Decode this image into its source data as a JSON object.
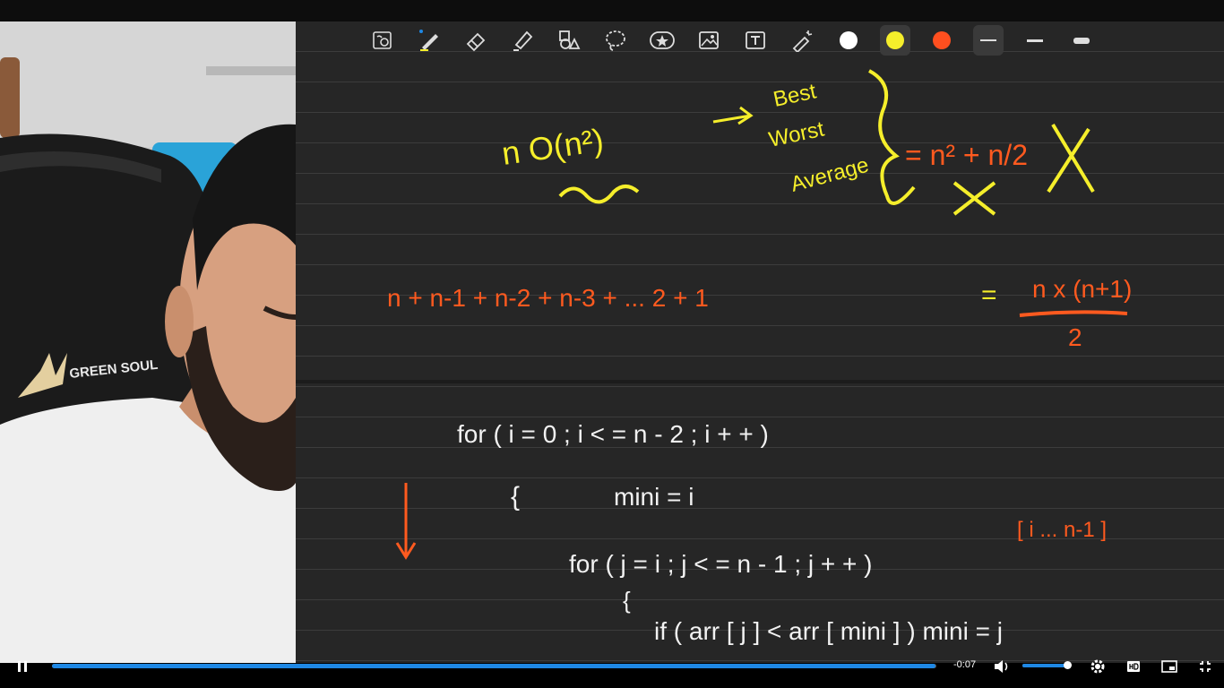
{
  "camera": {
    "chair_brand": "GREEN SOUL"
  },
  "toolbar": {
    "tools": [
      {
        "name": "lasso-zoom-icon"
      },
      {
        "name": "pen-icon"
      },
      {
        "name": "eraser-icon"
      },
      {
        "name": "highlighter-icon"
      },
      {
        "name": "shapes-icon"
      },
      {
        "name": "lasso-icon"
      },
      {
        "name": "sticker-icon"
      },
      {
        "name": "image-icon"
      },
      {
        "name": "text-icon"
      },
      {
        "name": "laser-pointer-icon"
      }
    ],
    "colors": [
      "#ffffff",
      "#f5ee2b",
      "#ff4f1f"
    ],
    "selected_color": "#f5ee2b",
    "stroke_widths": [
      "thin",
      "medium",
      "thick"
    ],
    "selected_stroke": "thin"
  },
  "board": {
    "yellow_notes": {
      "complexity": "n O(n²)",
      "cases": [
        "Best",
        "Worst",
        "Average"
      ],
      "formula": "= n² + n/2"
    },
    "series": {
      "sum": "n + n-1 + n-2 + n-3 + ... 2 + 1",
      "equals": "=",
      "numerator": "n x (n+1)",
      "denominator": "2"
    },
    "code": {
      "line1": "for ( i = 0 ; i < = n - 2 ; i + + )",
      "line2_brace": "{",
      "line2": "mini = i",
      "line3": "for ( j = i ; j < = n - 1 ; j + + )",
      "line4_brace": "{",
      "line4": "if ( arr [ j ] < arr [ mini ] ) mini = j",
      "range_note": "[ i ... n-1 ]"
    },
    "ink_colors": {
      "white": "#f2f2f2",
      "yellow": "#f5ee2b",
      "orange": "#ff5a1f"
    }
  },
  "player": {
    "time_remaining": "-0:07",
    "progress": 0.999,
    "volume": 1.0,
    "controls": [
      "pause-icon",
      "volume-icon",
      "settings-icon",
      "hd-icon",
      "miniplayer-icon",
      "exit-fullscreen-icon"
    ]
  }
}
